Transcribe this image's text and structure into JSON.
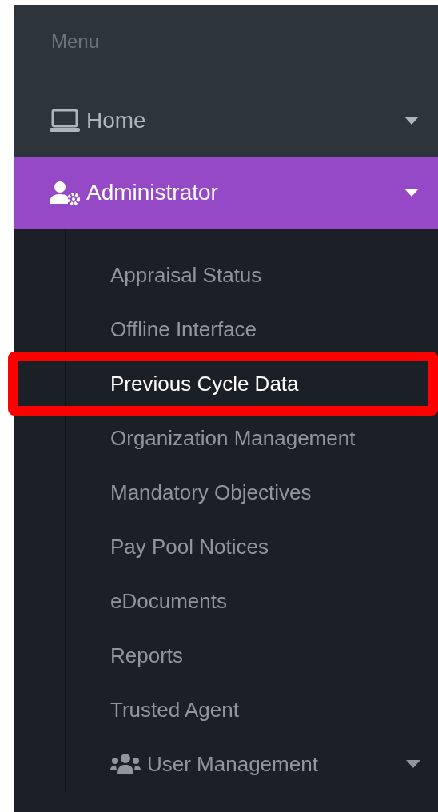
{
  "sidebar": {
    "heading": "Menu",
    "items": [
      {
        "label": "Home",
        "kind": "laptop",
        "selected": false
      },
      {
        "label": "Administrator",
        "kind": "user-gear",
        "selected": true,
        "children": [
          {
            "label": "Appraisal Status",
            "selected": false
          },
          {
            "label": "Offline Interface",
            "selected": false
          },
          {
            "label": "Previous Cycle Data",
            "selected": true,
            "highlighted": true
          },
          {
            "label": "Organization Management",
            "selected": false
          },
          {
            "label": "Mandatory Objectives",
            "selected": false
          },
          {
            "label": "Pay Pool Notices",
            "selected": false
          },
          {
            "label": "eDocuments",
            "selected": false
          },
          {
            "label": "Reports",
            "selected": false
          },
          {
            "label": "Trusted Agent",
            "selected": false
          },
          {
            "label": "User Management",
            "kind": "users",
            "selected": false
          }
        ]
      }
    ]
  }
}
